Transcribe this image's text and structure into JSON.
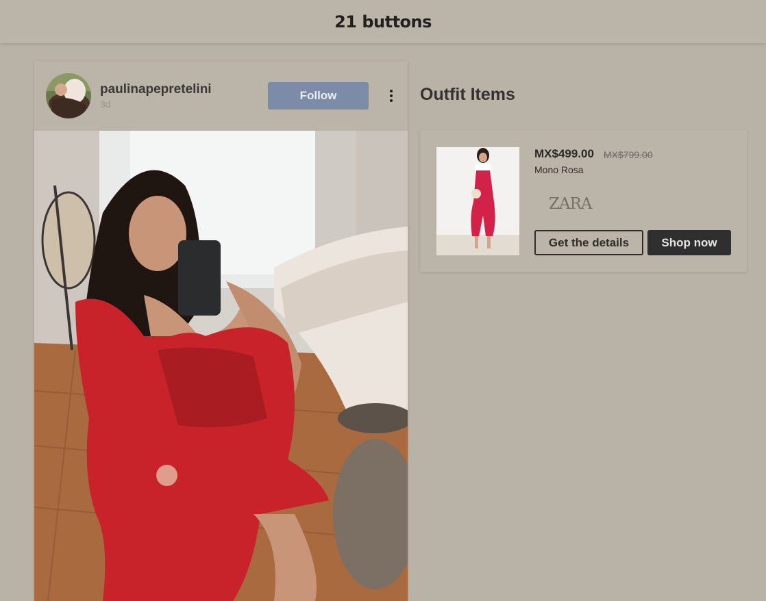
{
  "header": {
    "logo_text": "21 buttons"
  },
  "post": {
    "username": "paulinapepretelini",
    "time_ago": "3d",
    "follow_label": "Follow",
    "more_icon": "more-vertical-icon"
  },
  "outfit": {
    "title": "Outfit Items",
    "items": [
      {
        "price": "MX$499.00",
        "old_price": "MX$799.00",
        "name": "Mono Rosa",
        "brand": "ZARA",
        "details_label": "Get the details",
        "shop_label": "Shop now"
      }
    ]
  },
  "colors": {
    "background": "#b9b2a7",
    "follow_button": "#7b8ba8",
    "shop_button": "#2f2f2f",
    "dress": "#c8232a"
  }
}
